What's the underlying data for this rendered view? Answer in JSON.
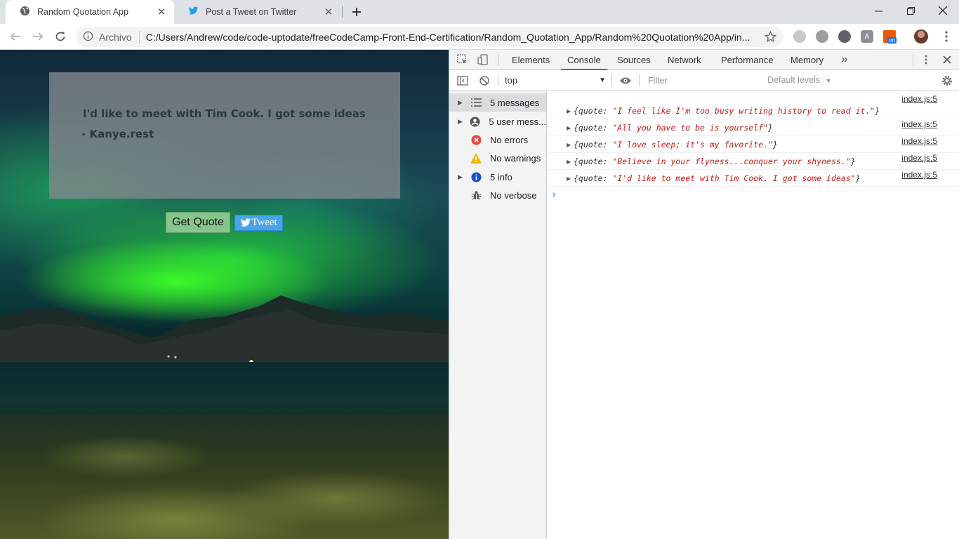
{
  "browser": {
    "tabs": [
      {
        "title": "Random Quotation App",
        "active": true,
        "icon": "globe-icon"
      },
      {
        "title": "Post a Tweet on Twitter",
        "active": false,
        "icon": "twitter-bird-icon"
      }
    ],
    "window_controls": [
      "minimize-icon",
      "restore-icon",
      "close-icon"
    ],
    "address": {
      "scheme_label": "Archivo",
      "url": "C:/Users/Andrew/code/code-uptodate/freeCodeCamp-Front-End-Certification/Random_Quotation_App/Random%20Quotation%20App/in..."
    },
    "extensions": [
      "extension-icon",
      "extension-icon",
      "extension-icon",
      "extension-icon",
      "extension-icon",
      "profile-avatar"
    ],
    "extension_badge": "on"
  },
  "page": {
    "quote": "I'd like to meet with Tim Cook. I got some ideas",
    "author": "- Kanye.rest",
    "get_quote_label": "Get Quote",
    "tweet_label": "Tweet"
  },
  "devtools": {
    "tabs": [
      "Elements",
      "Console",
      "Sources",
      "Network",
      "Performance",
      "Memory"
    ],
    "active_tab": "Console",
    "context": "top",
    "filter_placeholder": "Filter",
    "levels_label": "Default levels",
    "sidebar": [
      {
        "label": "5 messages",
        "icon": "list-icon",
        "expandable": true,
        "selected": true
      },
      {
        "label": "5 user mess...",
        "icon": "user-icon",
        "expandable": true,
        "selected": false
      },
      {
        "label": "No errors",
        "icon": "error-icon",
        "expandable": false,
        "selected": false
      },
      {
        "label": "No warnings",
        "icon": "warning-icon",
        "expandable": false,
        "selected": false
      },
      {
        "label": "5 info",
        "icon": "info-icon",
        "expandable": true,
        "selected": false
      },
      {
        "label": "No verbose",
        "icon": "bug-icon",
        "expandable": false,
        "selected": false
      }
    ],
    "logs": [
      {
        "prefix": "{quote: ",
        "value": "\"I feel like I'm too busy writing history to read it.\"",
        "suffix": "}",
        "source": "index.js:5"
      },
      {
        "prefix": "{quote: ",
        "value": "\"All you have to be is yourself\"",
        "suffix": "}",
        "source": "index.js:5"
      },
      {
        "prefix": "{quote: ",
        "value": "\"I love sleep; it's my favorite.\"",
        "suffix": "}",
        "source": "index.js:5"
      },
      {
        "prefix": "{quote: ",
        "value": "\"Believe in your flyness...conquer your shyness.\"",
        "suffix": "}",
        "source": "index.js:5"
      },
      {
        "prefix": "{quote: ",
        "value": "\"I'd like to meet with Tim Cook. I got some ideas\"",
        "suffix": "}",
        "source": "index.js:5"
      }
    ],
    "prompt_symbol": "›"
  },
  "colors": {
    "accent": "#1a73e8",
    "string": "#c41a16",
    "get_quote_bg": "#86c68c",
    "tweet_bg": "#4aa4e8"
  }
}
